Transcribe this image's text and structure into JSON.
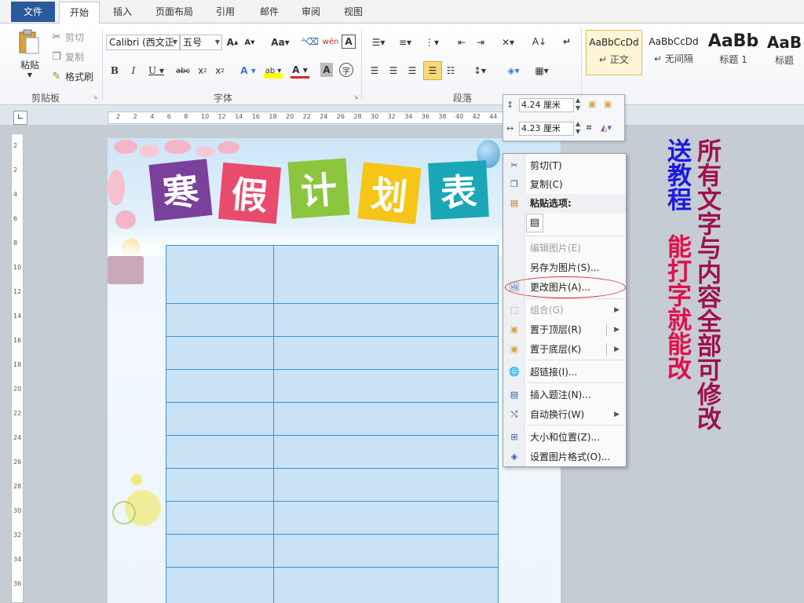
{
  "tabs": {
    "file": "文件",
    "items": [
      "开始",
      "插入",
      "页面布局",
      "引用",
      "邮件",
      "审阅",
      "视图"
    ]
  },
  "ribbon": {
    "clipboard": {
      "paste": "粘贴",
      "cut": "剪切",
      "copy": "复制",
      "format_painter": "格式刷",
      "group_label": "剪贴板"
    },
    "font": {
      "font_name": "Calibri (西文正",
      "font_size": "五号",
      "group_label": "字体"
    },
    "paragraph": {
      "group_label": "段落"
    },
    "styles": [
      {
        "sample": "AaBbCcDd",
        "name": "正文"
      },
      {
        "sample": "AaBbCcDd",
        "name": "无间隔"
      },
      {
        "sample": "AaBb",
        "name": "标题 1"
      },
      {
        "sample": "AaB",
        "name": "标题"
      }
    ]
  },
  "ruler": {
    "labels": [
      "2",
      "2",
      "4",
      "6",
      "8",
      "10",
      "12",
      "14",
      "16",
      "18",
      "20",
      "22",
      "24",
      "26",
      "28",
      "30",
      "32",
      "34",
      "36",
      "38",
      "40",
      "42",
      "44",
      "46"
    ],
    "vlabels": [
      "2",
      "2",
      "4",
      "6",
      "8",
      "10",
      "12",
      "14",
      "16",
      "18",
      "20",
      "22",
      "24",
      "26",
      "28",
      "30",
      "32",
      "34",
      "36"
    ]
  },
  "poster": {
    "title_chars": [
      "寒",
      "假",
      "计",
      "划",
      "表"
    ],
    "block_colors": [
      "#7b3f9c",
      "#e84b6b",
      "#8cc63f",
      "#f5c518",
      "#1aa6b7"
    ]
  },
  "picture_toolbar": {
    "height": "4.24 厘米",
    "width": "4.23 厘米"
  },
  "context_menu": {
    "cut": "剪切(T)",
    "copy": "复制(C)",
    "paste_options": "粘贴选项:",
    "edit_picture": "编辑图片(E)",
    "save_as_picture": "另存为图片(S)...",
    "change_picture": "更改图片(A)...",
    "group": "组合(G)",
    "bring_to_front": "置于顶层(R)",
    "send_to_back": "置于底层(K)",
    "hyperlink": "超链接(I)...",
    "insert_caption": "插入题注(N)...",
    "wrap_text": "自动换行(W)",
    "size_position": "大小和位置(Z)...",
    "format_picture": "设置图片格式(O)..."
  },
  "promo": {
    "tutorial": "送教程",
    "type_to_edit": "能打字就能改",
    "all_editable": "所有文字与内容全部可修改"
  }
}
